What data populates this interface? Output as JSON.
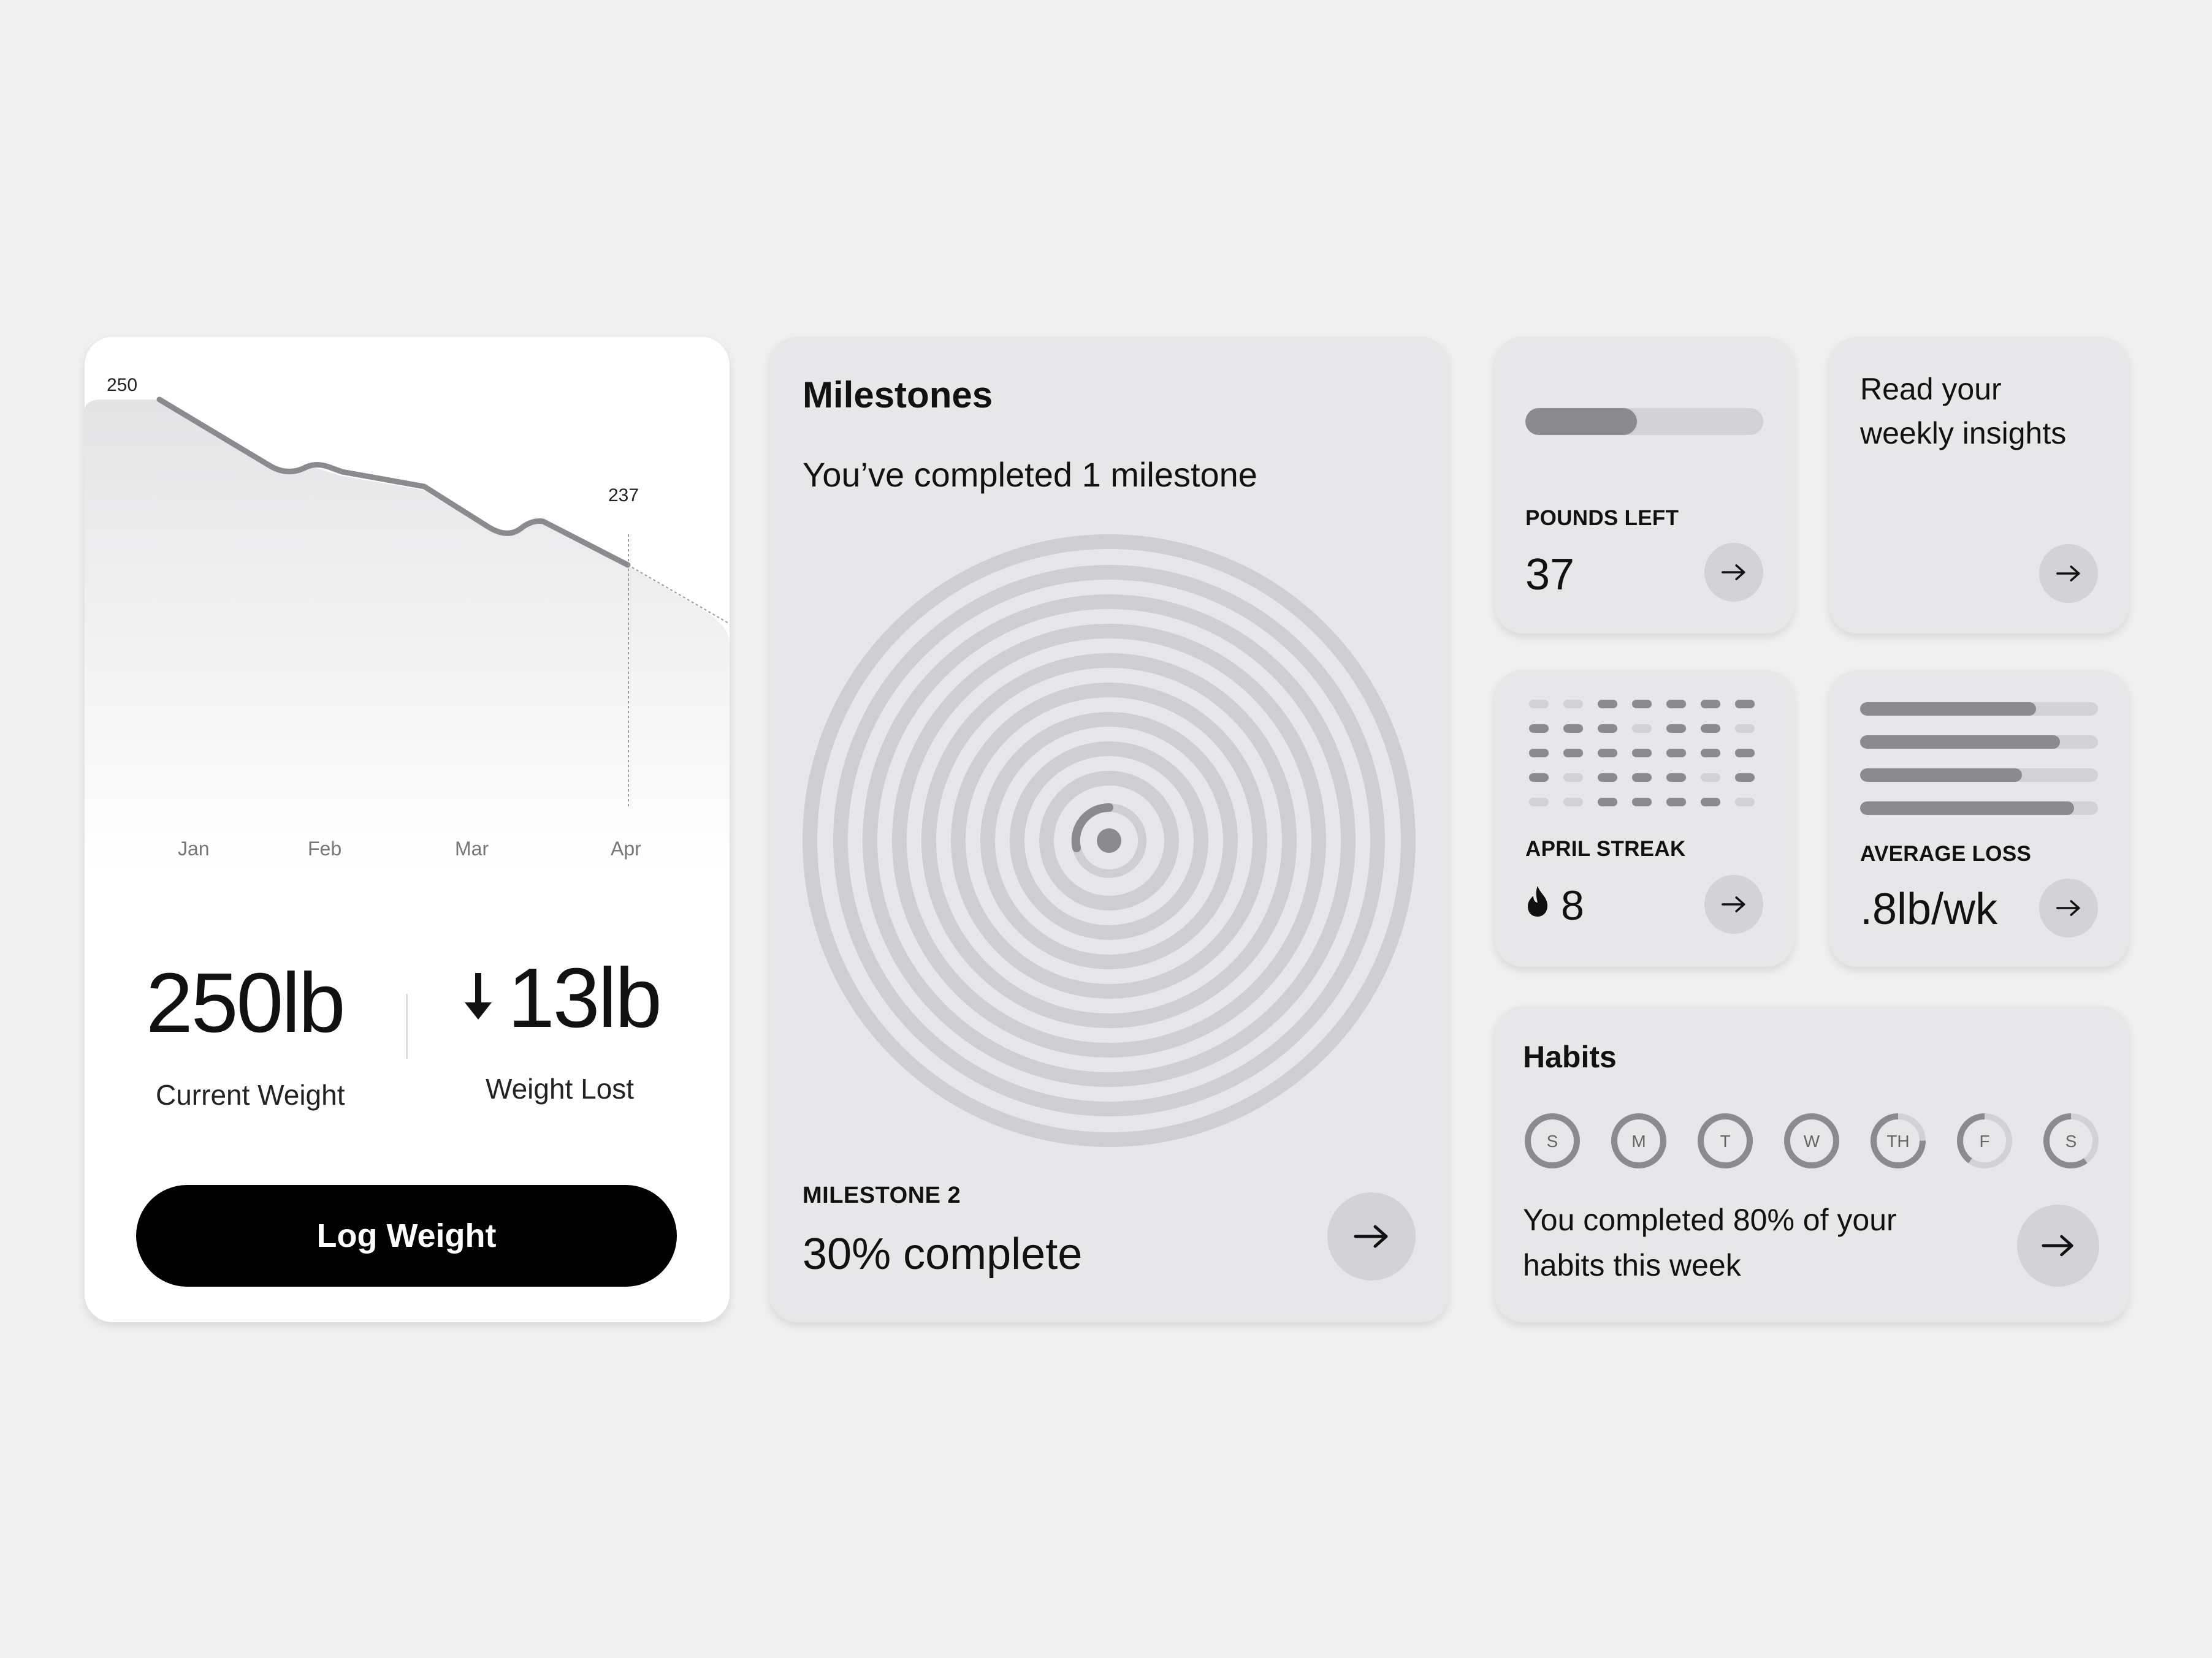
{
  "weight_card": {
    "chart_data": {
      "type": "line",
      "categories": [
        "Jan",
        "Feb",
        "Mar",
        "Apr"
      ],
      "point_labels": [
        "250",
        "237"
      ],
      "start_value": 250,
      "end_value": 237
    },
    "current_weight_value": "250lb",
    "current_weight_label": "Current Weight",
    "weight_lost_value": "13lb",
    "weight_lost_label": "Weight Lost",
    "log_button_label": "Log Weight"
  },
  "milestones": {
    "title": "Milestones",
    "subtitle": "You’ve completed 1 milestone",
    "milestone_label": "MILESTONE 2",
    "milestone_progress_text": "30% complete",
    "milestone_progress": 0.3
  },
  "pounds_left": {
    "label": "POUNDS LEFT",
    "value": "37",
    "progress": 0.47
  },
  "insights": {
    "text_line1": "Read your",
    "text_line2": "weekly insights"
  },
  "april_streak": {
    "label": "APRIL STREAK",
    "value": "8",
    "icon": "flame-icon"
  },
  "average_loss": {
    "label": "AVERAGE LOSS",
    "value": ".8lb/wk",
    "bar_levels": [
      0.74,
      0.84,
      0.68,
      0.9
    ]
  },
  "habits": {
    "title": "Habits",
    "days": [
      {
        "label": "S",
        "progress": 1.0
      },
      {
        "label": "M",
        "progress": 1.0
      },
      {
        "label": "T",
        "progress": 1.0
      },
      {
        "label": "W",
        "progress": 1.0
      },
      {
        "label": "TH",
        "progress": 0.75
      },
      {
        "label": "F",
        "progress": 0.4
      },
      {
        "label": "S",
        "progress": 0.6
      }
    ],
    "summary_line1": "You completed 80% of your",
    "summary_line2": "habits this week"
  },
  "colors": {
    "background": "#f0f0f0",
    "card_grey": "#e7e7ea",
    "accent_dark": "#8a8a8f",
    "button_black": "#000000"
  }
}
